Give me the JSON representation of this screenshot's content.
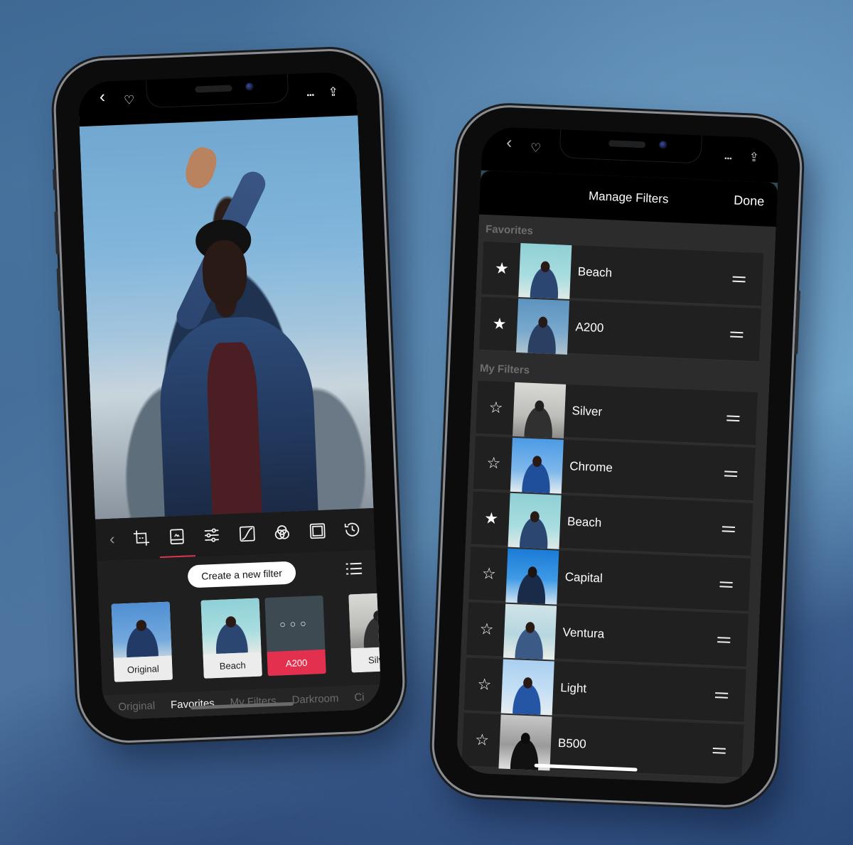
{
  "background": {
    "gradient_colors": [
      "#3f6994",
      "#6a9ec4",
      "#2a4878"
    ]
  },
  "accent_color": "#e3304f",
  "left_phone": {
    "top_bar": {
      "back_icon": "chevron-left-icon",
      "favorite_icon": "heart-icon",
      "more_icon": "ellipsis-icon",
      "share_icon": "share-icon",
      "back_glyph": "‹",
      "favorite_glyph": "♡",
      "more_glyph": "•••",
      "share_glyph": "⇪"
    },
    "toolbar": {
      "back_glyph": "‹",
      "tools": [
        {
          "name": "crop",
          "active": false
        },
        {
          "name": "filters",
          "active": true
        },
        {
          "name": "adjust",
          "active": false
        },
        {
          "name": "curves",
          "active": false
        },
        {
          "name": "color-mix",
          "active": false
        },
        {
          "name": "frame",
          "active": false
        },
        {
          "name": "history",
          "active": false
        }
      ]
    },
    "create_filter_label": "Create a new filter",
    "filter_thumbnails": [
      {
        "label": "Original",
        "style": "blue"
      },
      {
        "label": "Beach",
        "style": "beach"
      },
      {
        "label": "A200",
        "style": "more",
        "dots": "○○○",
        "selected": true
      },
      {
        "label": "Silver",
        "style": "silver"
      }
    ],
    "category_tabs": [
      {
        "label": "Original",
        "active": false
      },
      {
        "label": "Favorites",
        "active": true
      },
      {
        "label": "My Filters",
        "active": false
      },
      {
        "label": "Darkroom",
        "active": false
      },
      {
        "label": "Ci",
        "active": false
      }
    ]
  },
  "right_phone": {
    "top_bar": {
      "back_glyph": "‹",
      "favorite_glyph": "♡",
      "more_glyph": "•••",
      "share_glyph": "⇪"
    },
    "sheet": {
      "title": "Manage Filters",
      "done_label": "Done",
      "sections": [
        {
          "label": "Favorites",
          "rows": [
            {
              "name": "Beach",
              "favorite": true,
              "style": "beach"
            },
            {
              "name": "A200",
              "favorite": true,
              "style": "a200"
            }
          ]
        },
        {
          "label": "My Filters",
          "rows": [
            {
              "name": "Silver",
              "favorite": false,
              "style": "silver"
            },
            {
              "name": "Chrome",
              "favorite": false,
              "style": "chrome"
            },
            {
              "name": "Beach",
              "favorite": true,
              "style": "beach"
            },
            {
              "name": "Capital",
              "favorite": false,
              "style": "capital"
            },
            {
              "name": "Ventura",
              "favorite": false,
              "style": "ventura"
            },
            {
              "name": "Light",
              "favorite": false,
              "style": "light"
            },
            {
              "name": "B500",
              "favorite": false,
              "style": "b500"
            }
          ]
        }
      ],
      "star_filled_glyph": "★",
      "star_empty_glyph": "☆"
    }
  }
}
